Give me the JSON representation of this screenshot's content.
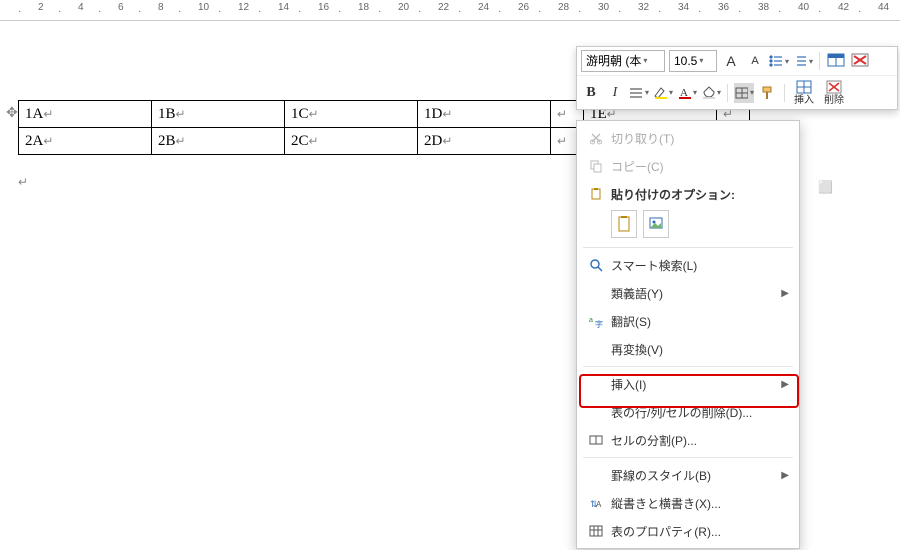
{
  "ruler": {
    "start": 2,
    "end": 44,
    "step": 2
  },
  "table": {
    "rows": [
      [
        "1A",
        "1B",
        "1C",
        "1D",
        "",
        "1E",
        ""
      ],
      [
        "2A",
        "2B",
        "2C",
        "2D",
        "",
        "",
        ""
      ]
    ]
  },
  "mini_toolbar": {
    "font_name": "游明朝 (本",
    "font_size": "10.5",
    "grow_font": "A",
    "shrink_font": "A",
    "bold": "B",
    "italic": "I",
    "insert_label": "挿入",
    "delete_label": "削除"
  },
  "context_menu": {
    "cut": "切り取り(T)",
    "copy": "コピー(C)",
    "paste_options": "貼り付けのオプション:",
    "smart_lookup": "スマート検索(L)",
    "synonyms": "類義語(Y)",
    "translate": "翻訳(S)",
    "reconvert": "再変換(V)",
    "insert": "挿入(I)",
    "delete_cells": "表の行/列/セルの削除(D)...",
    "split_cells": "セルの分割(P)...",
    "border_style": "罫線のスタイル(B)",
    "text_direction": "縦書きと横書き(X)...",
    "table_properties": "表のプロパティ(R)..."
  }
}
